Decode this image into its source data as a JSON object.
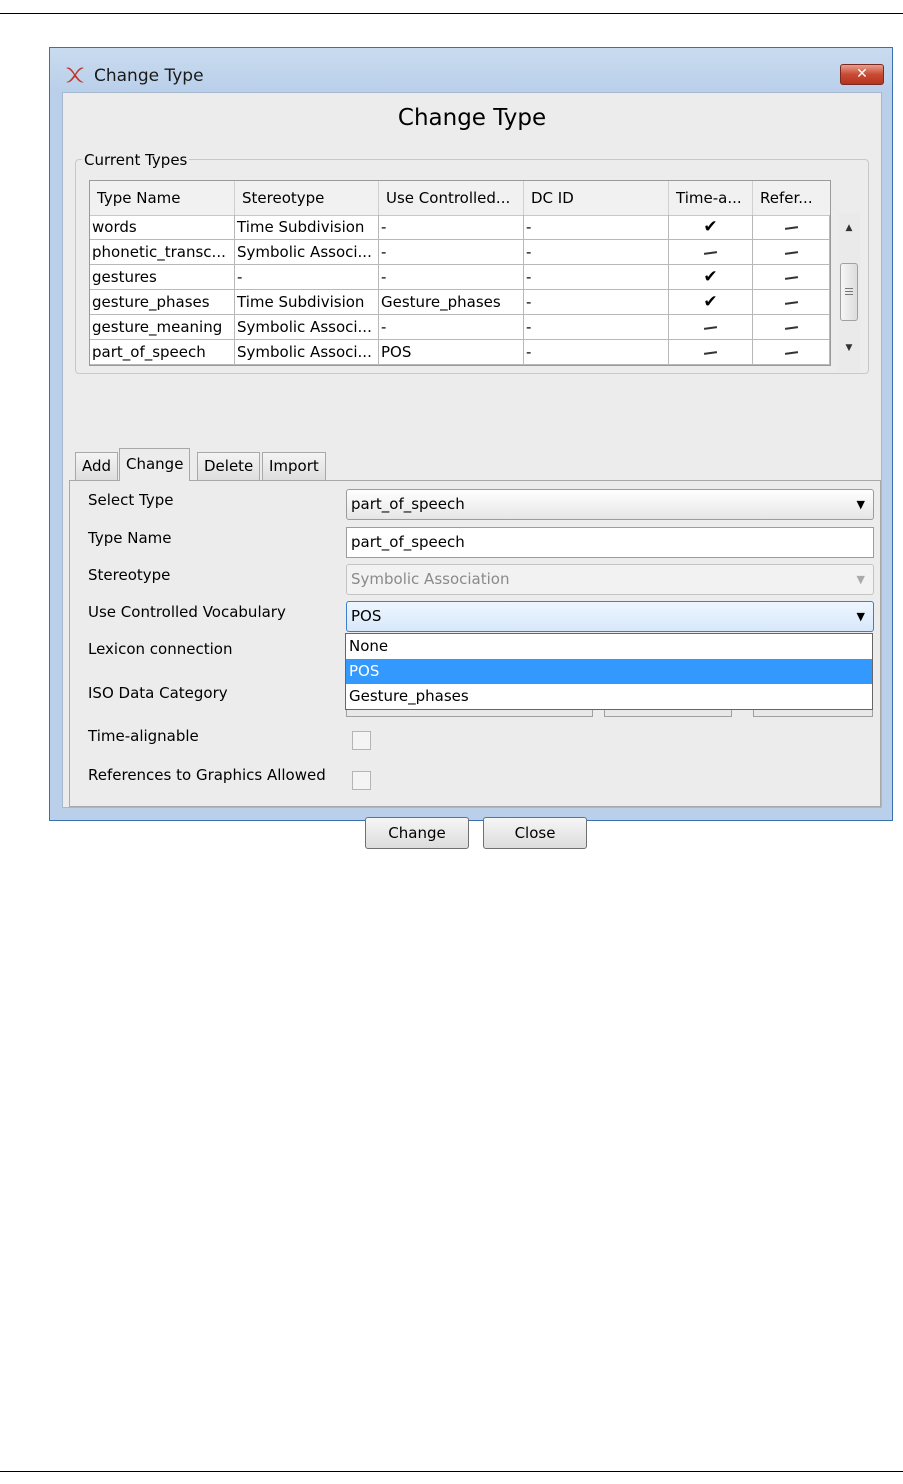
{
  "window": {
    "title": "Change Type",
    "close_glyph": "✕"
  },
  "dialog": {
    "heading": "Change Type"
  },
  "current_types": {
    "legend": "Current Types",
    "columns": [
      "Type Name",
      "Stereotype",
      "Use Controlled...",
      "DC ID",
      "Time-a...",
      "Refer..."
    ],
    "rows": [
      {
        "type_name": "words",
        "stereotype": "Time Subdivision",
        "controlled_vocabulary": "-",
        "dc_id": "-",
        "time_alignable": "✔",
        "references": "dash"
      },
      {
        "type_name": "phonetic_transc...",
        "stereotype": "Symbolic Associ...",
        "controlled_vocabulary": "-",
        "dc_id": "-",
        "time_alignable": "dash",
        "references": "dash"
      },
      {
        "type_name": "gestures",
        "stereotype": "-",
        "controlled_vocabulary": "-",
        "dc_id": "-",
        "time_alignable": "✔",
        "references": "dash"
      },
      {
        "type_name": "gesture_phases",
        "stereotype": "Time Subdivision",
        "controlled_vocabulary": "Gesture_phases",
        "dc_id": "-",
        "time_alignable": "✔",
        "references": "dash"
      },
      {
        "type_name": "gesture_meaning",
        "stereotype": "Symbolic Associ...",
        "controlled_vocabulary": "-",
        "dc_id": "-",
        "time_alignable": "dash",
        "references": "dash"
      },
      {
        "type_name": "part_of_speech",
        "stereotype": "Symbolic Associ...",
        "controlled_vocabulary": "POS",
        "dc_id": "-",
        "time_alignable": "dash",
        "references": "dash"
      }
    ]
  },
  "tabs": [
    {
      "label": "Add",
      "active": false
    },
    {
      "label": "Change",
      "active": true
    },
    {
      "label": "Delete",
      "active": false
    },
    {
      "label": "Import",
      "active": false
    }
  ],
  "form": {
    "select_type_label": "Select Type",
    "select_type_value": "part_of_speech",
    "type_name_label": "Type Name",
    "type_name_value": "part_of_speech",
    "stereotype_label": "Stereotype",
    "stereotype_value": "Symbolic Association",
    "cv_label": "Use Controlled Vocabulary",
    "cv_value": "POS",
    "cv_options": [
      "None",
      "POS",
      "Gesture_phases"
    ],
    "cv_selected_index": 1,
    "lexicon_label": "Lexicon connection",
    "iso_label": "ISO Data Category",
    "time_alignable_label": "Time-alignable",
    "time_alignable_checked": false,
    "references_label": "References to Graphics Allowed",
    "references_checked": false
  },
  "buttons": {
    "change_label": "Change",
    "close_label": "Close"
  },
  "colors": {
    "selection": "#3399ff",
    "titlebar": "#b9cfea",
    "close_button": "#c94a33"
  }
}
